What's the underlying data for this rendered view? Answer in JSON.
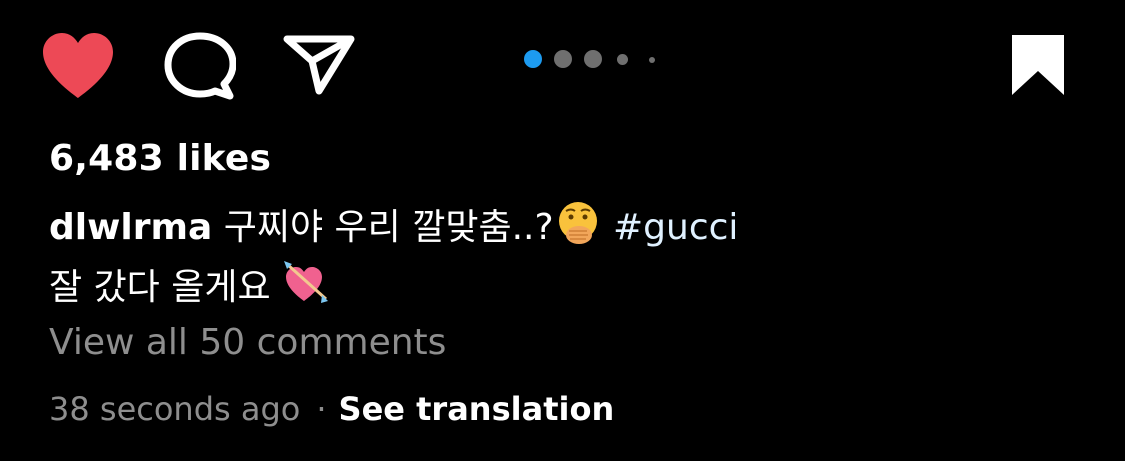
{
  "actions": {
    "like_icon": "heart-filled-icon",
    "comment_icon": "speech-bubble-icon",
    "share_icon": "paper-plane-icon",
    "save_icon": "bookmark-filled-icon",
    "like_color": "#ed4956",
    "active_dot_color": "#1d9bf0",
    "inactive_dot_color": "#6f6f6f"
  },
  "carousel": {
    "total_dots_visible": 5,
    "active_index": 0
  },
  "post": {
    "likes_text": "6,483 likes",
    "username": "dlwlrma",
    "caption_line1": "구찌야 우리 깔맞춤..?",
    "emoji_1": "hand-over-mouth-emoji",
    "hashtag": "#gucci",
    "caption_line2": "잘 갔다 올게요",
    "emoji_2": "heart-with-arrow-emoji",
    "view_comments": "View all 50 comments",
    "timestamp": "38 seconds ago",
    "separator": "·",
    "see_translation": "See translation"
  }
}
